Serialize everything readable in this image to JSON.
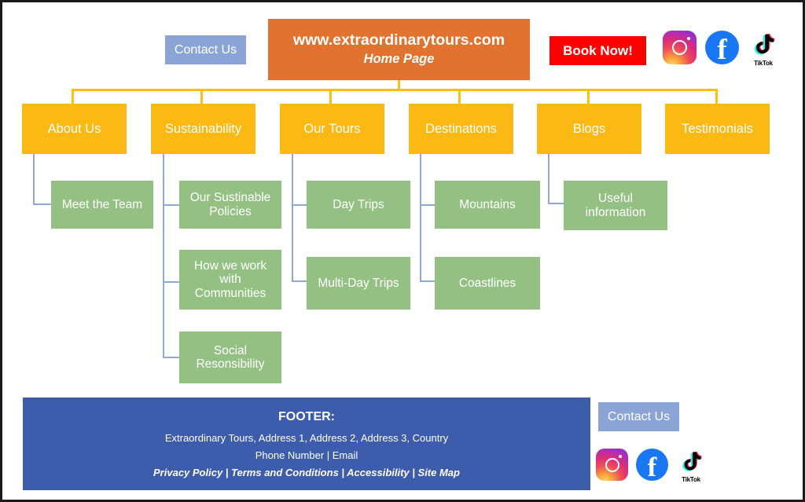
{
  "diagram": {
    "type": "sitemap-tree",
    "title": "Extraordinary Tours website sitemap",
    "colors": {
      "home": "#e2722f",
      "nav": "#fcb813",
      "subpage": "#94c183",
      "footer": "#3d5cab",
      "contact_button": "#8ba4d6",
      "book_button": "#fe0000",
      "connector_blue": "#8ea9d8",
      "connector_orange": "#fcbf12"
    }
  },
  "header": {
    "contact_button": "Contact Us",
    "home": {
      "url": "www.extraordinarytours.com",
      "subtitle": "Home Page"
    },
    "book_button": "Book Now!",
    "social": [
      {
        "name": "instagram-icon",
        "label": "Instagram"
      },
      {
        "name": "facebook-icon",
        "label": "Facebook"
      },
      {
        "name": "tiktok-icon",
        "label": "TikTok"
      }
    ]
  },
  "nav": [
    {
      "label": "About Us",
      "children": [
        {
          "label": "Meet the Team"
        }
      ]
    },
    {
      "label": "Sustainability",
      "children": [
        {
          "label": "Our Sustinable Policies"
        },
        {
          "label": "How we work with Communities"
        },
        {
          "label": "Social Resonsibility"
        }
      ]
    },
    {
      "label": "Our Tours",
      "children": [
        {
          "label": "Day Trips"
        },
        {
          "label": "Multi-Day Trips"
        }
      ]
    },
    {
      "label": "Destinations",
      "children": [
        {
          "label": "Mountains"
        },
        {
          "label": "Coastlines"
        }
      ]
    },
    {
      "label": "Blogs",
      "children": [
        {
          "label": "Useful information"
        }
      ]
    },
    {
      "label": "Testimonials",
      "children": []
    }
  ],
  "footer": {
    "title": "FOOTER:",
    "address": "Extraordinary Tours, Address 1, Address 2, Address 3, Country",
    "contact_line": "Phone Number | Email",
    "links": "Privacy Policy | Terms and Conditions | Accessibility | Site Map",
    "contact_button": "Contact Us",
    "social": [
      {
        "name": "instagram-icon",
        "label": "Instagram"
      },
      {
        "name": "facebook-icon",
        "label": "Facebook"
      },
      {
        "name": "tiktok-icon",
        "label": "TikTok"
      }
    ],
    "tiktok_caption": "TikTok"
  }
}
